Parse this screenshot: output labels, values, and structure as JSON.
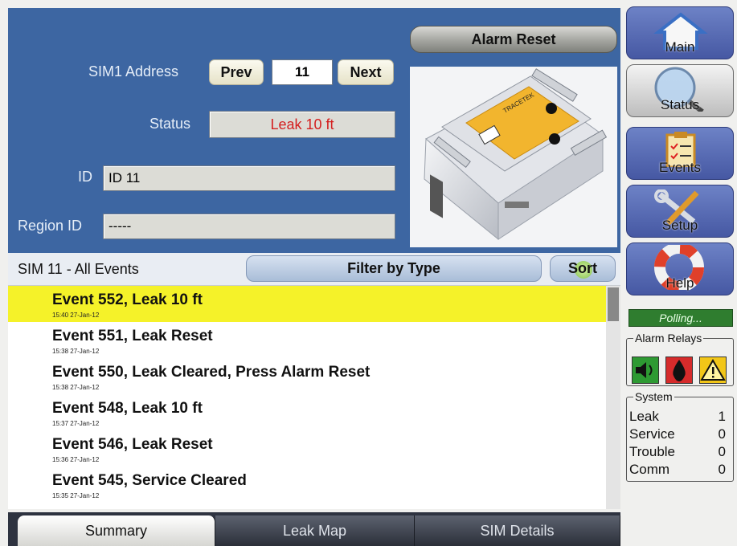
{
  "header": {
    "alarm_reset_label": "Alarm Reset",
    "address_label": "SIM1 Address",
    "prev_label": "Prev",
    "address_value": "11",
    "next_label": "Next",
    "status_label": "Status",
    "status_value": "Leak 10 ft",
    "id_label": "ID",
    "id_value": "ID 11",
    "region_label": "Region ID",
    "region_value": "-----"
  },
  "device_photo": {
    "brand_text": "TRACETEK"
  },
  "events": {
    "title": "SIM 11 - All Events",
    "filter_label": "Filter by Type",
    "sort_label": "Sort",
    "items": [
      {
        "title": "Event 552, Leak 10 ft",
        "time": "15:40 27-Jan-12",
        "highlighted": true
      },
      {
        "title": "Event 551, Leak Reset",
        "time": "15:38 27-Jan-12",
        "highlighted": false
      },
      {
        "title": "Event 550, Leak Cleared, Press Alarm Reset",
        "time": "15:38 27-Jan-12",
        "highlighted": false
      },
      {
        "title": "Event 548, Leak 10 ft",
        "time": "15:37 27-Jan-12",
        "highlighted": false
      },
      {
        "title": "Event 546, Leak Reset",
        "time": "15:36 27-Jan-12",
        "highlighted": false
      },
      {
        "title": "Event 545, Service Cleared",
        "time": "15:35 27-Jan-12",
        "highlighted": false
      }
    ]
  },
  "tabs": [
    {
      "label": "Summary",
      "active": true
    },
    {
      "label": "Leak Map",
      "active": false
    },
    {
      "label": "SIM Details",
      "active": false
    }
  ],
  "nav": [
    {
      "label": "Main",
      "icon": "house-icon"
    },
    {
      "label": "Status",
      "icon": "magnifier-icon",
      "selected": true
    },
    {
      "label": "Events",
      "icon": "clipboard-icon"
    },
    {
      "label": "Setup",
      "icon": "tools-icon"
    },
    {
      "label": "Help",
      "icon": "lifebuoy-icon"
    }
  ],
  "polling": "Polling...",
  "alarm_relays": {
    "title": "Alarm Relays",
    "relays": [
      {
        "icon": "speaker-icon",
        "color": "#2e9a33"
      },
      {
        "icon": "drop-icon",
        "color": "#d62b2b"
      },
      {
        "icon": "warning-icon",
        "color": "#f2c618"
      }
    ]
  },
  "system": {
    "title": "System",
    "rows": [
      {
        "name": "Leak",
        "value": "1"
      },
      {
        "name": "Service",
        "value": "0"
      },
      {
        "name": "Trouble",
        "value": "0"
      },
      {
        "name": "Comm",
        "value": "0"
      }
    ]
  },
  "colors": {
    "panel_blue": "#3d66a2",
    "highlight": "#f5f229",
    "status_text": "#d41f1f"
  }
}
